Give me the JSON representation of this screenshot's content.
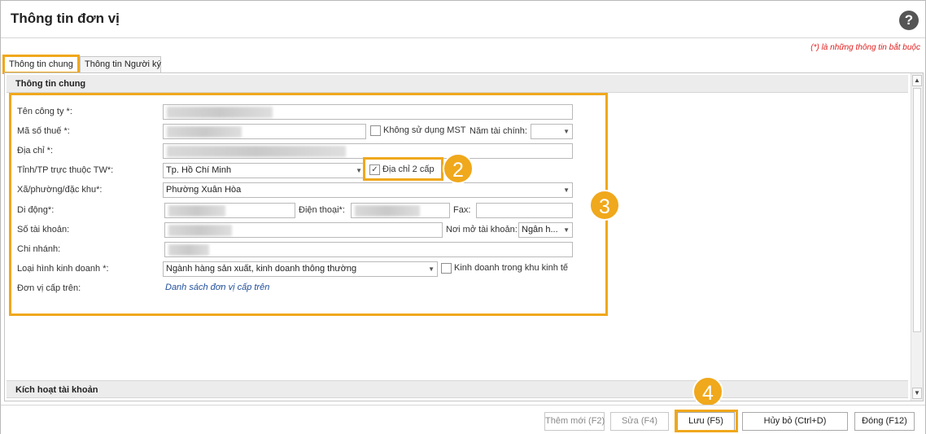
{
  "window": {
    "title": "Thông tin đơn vị",
    "help_glyph": "?",
    "required_note": "(*)  là những thông tin bắt buộc"
  },
  "tabs": [
    {
      "label": "Thông tin chung",
      "active": true
    },
    {
      "label": "Thông tin Người ký",
      "active": false
    }
  ],
  "groups": {
    "general": "Thông tin chung",
    "activate": "Kích hoạt tài khoản"
  },
  "form": {
    "company_name_label": "Tên công ty *:",
    "tax_code_label": "Mã số thuế *:",
    "no_tax_code_label": "Không sử dụng MST",
    "fiscal_year_label": "Năm tài chính:",
    "address_label": "Địa chỉ *:",
    "province_label": "Tỉnh/TP trực thuộc TW*:",
    "province_value": "Tp. Hồ Chí Minh",
    "two_level_address_label": "Địa chỉ 2 cấp",
    "ward_label": "Xã/phường/đặc khu*:",
    "ward_value": "Phường Xuân Hòa",
    "mobile_label": "Di động*:",
    "phone_label": "Điện thoại*:",
    "fax_label": "Fax:",
    "account_label": "Số tài khoản:",
    "bank_label": "Nơi mở tài khoản:",
    "bank_value": "Ngân h...",
    "branch_label": "Chi nhánh:",
    "business_type_label": "Loại hình kinh doanh *:",
    "business_type_value": "Ngành hàng sản xuất, kinh doanh thông thường",
    "economic_zone_label": "Kinh doanh trong khu kinh tế",
    "parent_unit_label": "Đơn vị cấp trên:",
    "parent_unit_link": "Danh sách đơn vị cấp trên"
  },
  "badges": {
    "b2": "2",
    "b3": "3",
    "b4": "4"
  },
  "buttons": {
    "add": "Thêm mới (F2)",
    "edit": "Sửa (F4)",
    "save": "Lưu (F5)",
    "cancel": "Hủy bỏ (Ctrl+D)",
    "close": "Đóng (F12)"
  },
  "colors": {
    "highlight": "#f0a81c",
    "required": "#e02020",
    "link": "#1f4e9a"
  }
}
